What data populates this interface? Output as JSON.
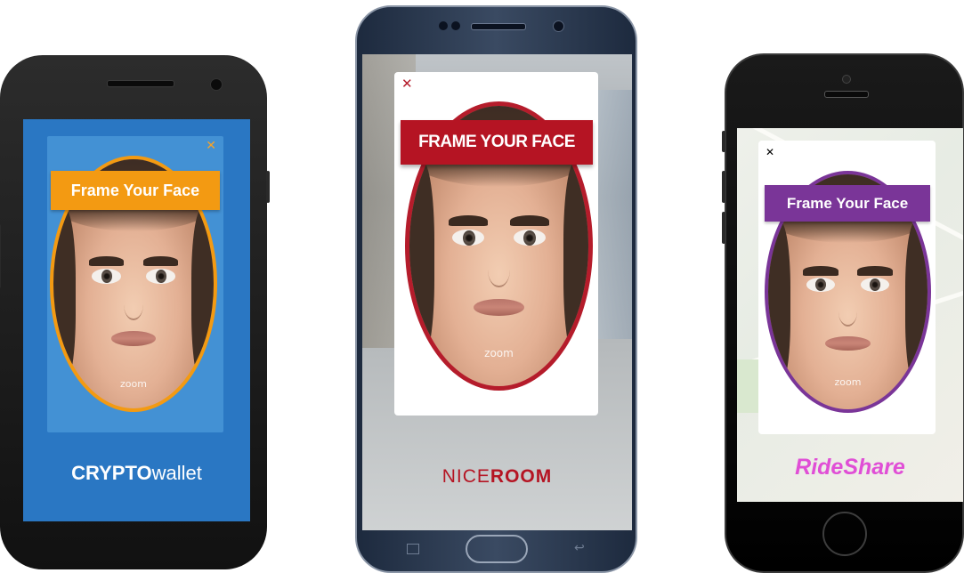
{
  "phones": [
    {
      "name": "crypto",
      "banner_text": "Frame Your Face",
      "close_glyph": "✕",
      "zoom_logo": "zoom",
      "brand": {
        "bold": "CRYPTO",
        "regular": "wallet"
      },
      "colors": {
        "screen": "#2a77c3",
        "card": "#4391d4",
        "frame": "#f39a12",
        "banner": "#f39a12",
        "close": "#f5a32a",
        "brand_text": "#ffffff"
      }
    },
    {
      "name": "niceroom",
      "banner_text": "FRAME YOUR FACE",
      "close_glyph": "✕",
      "zoom_logo": "zoom",
      "brand": {
        "regular": "NICE",
        "bold": "ROOM"
      },
      "colors": {
        "frame": "#b51c2b",
        "banner": "#b51423",
        "close": "#b51c2b",
        "brand_text": "#b51423"
      }
    },
    {
      "name": "rideshare",
      "banner_text": "Frame Your Face",
      "close_glyph": "✕",
      "zoom_logo": "zoom",
      "brand": {
        "text": "RideShare"
      },
      "colors": {
        "frame": "#7a3598",
        "banner": "#7a3598",
        "close": "#000000",
        "brand_text": "#e04fd6"
      }
    }
  ]
}
